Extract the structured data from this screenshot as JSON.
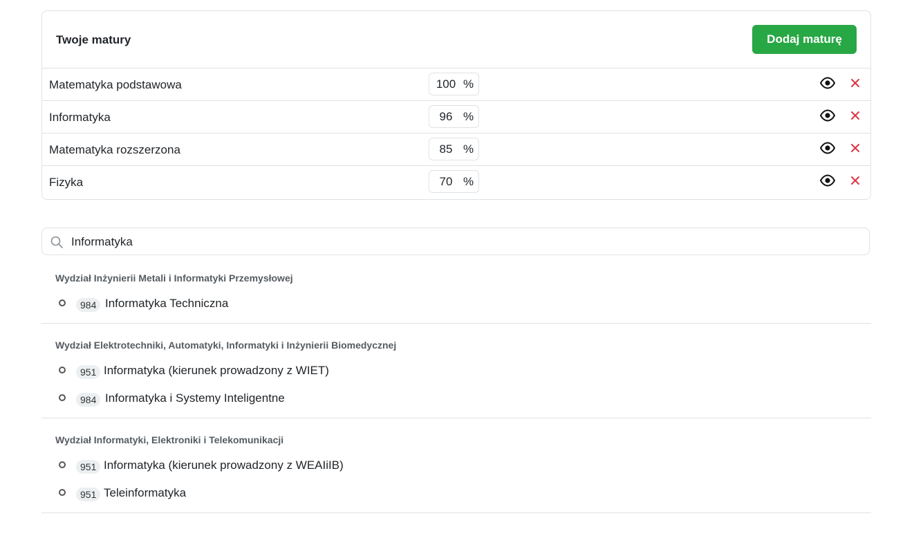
{
  "exams_card": {
    "title": "Twoje matury",
    "add_button_label": "Dodaj maturę",
    "rows": [
      {
        "subject": "Matematyka podstawowa",
        "score": "100",
        "unit": "%"
      },
      {
        "subject": "Informatyka",
        "score": "96",
        "unit": "%"
      },
      {
        "subject": "Matematyka rozszerzona",
        "score": "85",
        "unit": "%"
      },
      {
        "subject": "Fizyka",
        "score": "70",
        "unit": "%"
      }
    ]
  },
  "search": {
    "value": "Informatyka",
    "icon": "search-icon"
  },
  "results": [
    {
      "faculty": "Wydział Inżynierii Metali i Informatyki Przemysłowej",
      "programs": [
        {
          "code": "984",
          "name": "Informatyka Techniczna"
        }
      ]
    },
    {
      "faculty": "Wydział Elektrotechniki, Automatyki, Informatyki i Inżynierii Biomedycznej",
      "programs": [
        {
          "code": "951",
          "name": "Informatyka (kierunek prowadzony z WIET)"
        },
        {
          "code": "984",
          "name": "Informatyka i Systemy Inteligentne"
        }
      ]
    },
    {
      "faculty": "Wydział Informatyki, Elektroniki i Telekomunikacji",
      "programs": [
        {
          "code": "951",
          "name": "Informatyka (kierunek prowadzony z WEAIiIB)"
        },
        {
          "code": "951",
          "name": "Teleinformatyka"
        }
      ]
    }
  ],
  "colors": {
    "accent_green": "#28a745",
    "delete_red": "#dc3545",
    "border": "#dee2e6"
  }
}
